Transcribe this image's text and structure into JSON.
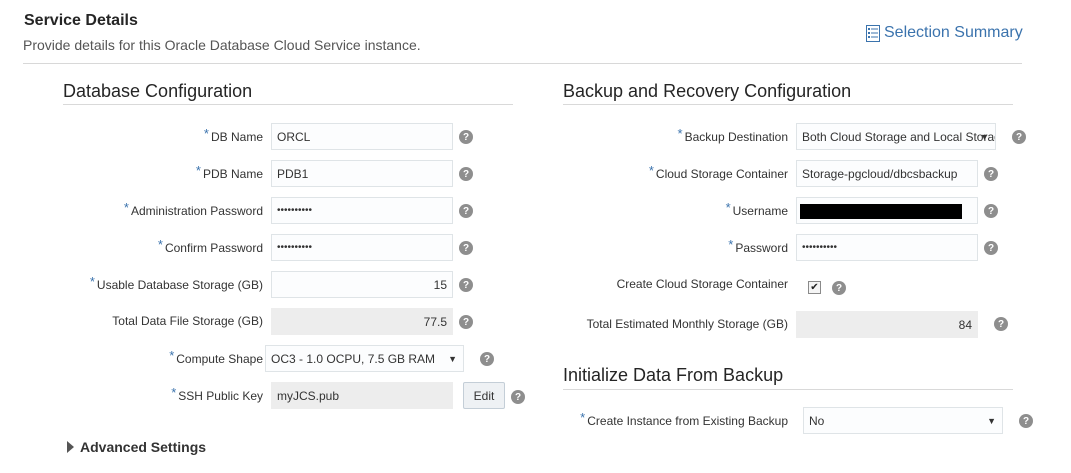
{
  "header": {
    "title": "Service Details",
    "subtitle": "Provide details for this Oracle Database Cloud Service instance.",
    "summary_link": "Selection Summary"
  },
  "required_marker": "*",
  "help_glyph": "?",
  "database_config": {
    "title": "Database Configuration",
    "db_name": {
      "label": "DB Name",
      "value": "ORCL"
    },
    "pdb_name": {
      "label": "PDB Name",
      "value": "PDB1"
    },
    "admin_password": {
      "label": "Administration Password",
      "value": "••••••••••"
    },
    "confirm_password": {
      "label": "Confirm Password",
      "value": "••••••••••"
    },
    "usable_storage": {
      "label": "Usable Database Storage (GB)",
      "value": "15"
    },
    "total_storage": {
      "label": "Total Data File Storage (GB)",
      "value": "77.5"
    },
    "compute_shape": {
      "label": "Compute Shape",
      "value": "OC3 - 1.0 OCPU, 7.5 GB RAM"
    },
    "ssh_key": {
      "label": "SSH Public Key",
      "value": "myJCS.pub",
      "edit_label": "Edit"
    }
  },
  "advanced_settings": {
    "label": "Advanced Settings"
  },
  "backup_config": {
    "title": "Backup and Recovery Configuration",
    "destination": {
      "label": "Backup Destination",
      "value": "Both Cloud Storage and Local Storage"
    },
    "container": {
      "label": "Cloud Storage Container",
      "value": "Storage-pgcloud/dbcsbackup"
    },
    "username": {
      "label": "Username",
      "value": ""
    },
    "password": {
      "label": "Password",
      "value": "••••••••••"
    },
    "create_container": {
      "label": "Create Cloud Storage Container",
      "checked": true
    },
    "monthly_storage": {
      "label": "Total Estimated Monthly Storage (GB)",
      "value": "84"
    }
  },
  "init_data": {
    "title": "Initialize Data From Backup",
    "from_backup": {
      "label": "Create Instance from Existing Backup",
      "value": "No"
    }
  },
  "colors": {
    "accent": "#3b73ad",
    "help_icon": "#8e8e8e",
    "readonly_bg": "#ededed"
  }
}
